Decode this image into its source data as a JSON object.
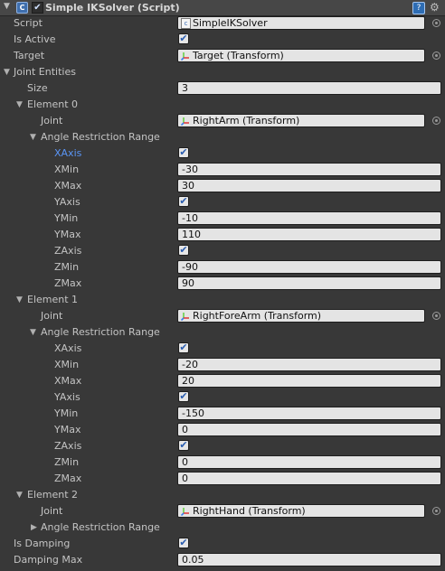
{
  "component": {
    "title": "Simple IKSolver (Script)",
    "enabled_glyph": "✔",
    "icons": [
      "script-component-icon",
      "help-icon",
      "gear-icon"
    ]
  },
  "props": {
    "script_label": "Script",
    "script_value": "SimpleIKSolver",
    "is_active_label": "Is Active",
    "target_label": "Target",
    "target_value": "Target (Transform)",
    "joint_entities_label": "Joint Entities",
    "size_label": "Size",
    "size_value": "3",
    "is_damping_label": "Is Damping",
    "damping_max_label": "Damping Max",
    "damping_max_value": "0.05"
  },
  "labels": {
    "joint": "Joint",
    "angle_range": "Angle Restriction Range",
    "xaxis": "XAxis",
    "xmin": "XMin",
    "xmax": "XMax",
    "yaxis": "YAxis",
    "ymin": "YMin",
    "ymax": "YMax",
    "zaxis": "ZAxis",
    "zmin": "ZMin",
    "zmax": "ZMax"
  },
  "elements": [
    {
      "label": "Element 0",
      "joint": "RightArm (Transform)",
      "xmin": "-30",
      "xmax": "30",
      "ymin": "-10",
      "ymax": "110",
      "zmin": "-90",
      "zmax": "90"
    },
    {
      "label": "Element 1",
      "joint": "RightForeArm (Transform)",
      "xmin": "-20",
      "xmax": "20",
      "ymin": "-150",
      "ymax": "0",
      "zmin": "0",
      "zmax": "0"
    },
    {
      "label": "Element 2",
      "joint": "RightHand (Transform)"
    }
  ],
  "check_glyph": "✔",
  "colors": {
    "background": "#383838",
    "header": "#474747",
    "field": "#e4e4e4",
    "highlight_label": "#5a95f5"
  }
}
